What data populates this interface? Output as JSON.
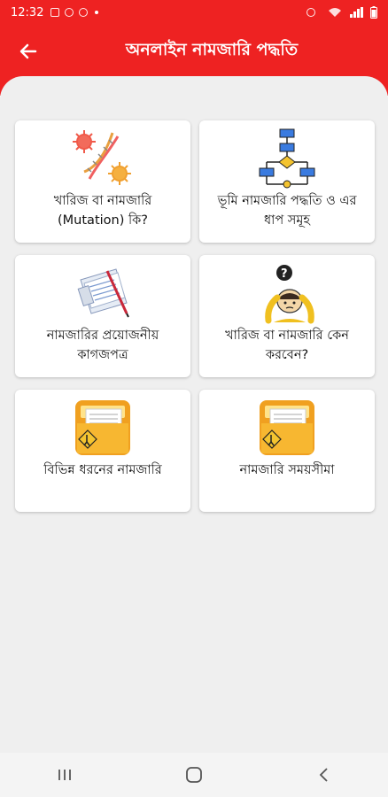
{
  "status_bar": {
    "time": "12:32"
  },
  "app_bar": {
    "title": "অনলাইন নামজারি পদ্ধতি",
    "back_icon": "arrow-left-icon"
  },
  "cards": [
    {
      "label": "খারিজ বা নামজারি (Mutation) কি?",
      "icon": "dna-virus-icon"
    },
    {
      "label": "ভূমি নামজারি পদ্ধতি ও এর ধাপ সমূহ",
      "icon": "flowchart-icon"
    },
    {
      "label": "নামজারির প্রয়োজনীয় কাগজপত্র",
      "icon": "documents-pen-icon"
    },
    {
      "label": "খারিজ বা নামজারি কেন করবেন?",
      "icon": "question-head-icon"
    },
    {
      "label": "বিভিন্ন ধরনের নামজারি",
      "icon": "folder-warning-icon"
    },
    {
      "label": "নামজারি সময়সীমা",
      "icon": "folder-warning-icon"
    }
  ],
  "colors": {
    "primary": "#ee2222",
    "background": "#efefef",
    "card": "#ffffff"
  },
  "nav_bar": {
    "recent_icon": "recent-apps-icon",
    "home_icon": "home-icon",
    "back_icon": "nav-back-icon"
  }
}
